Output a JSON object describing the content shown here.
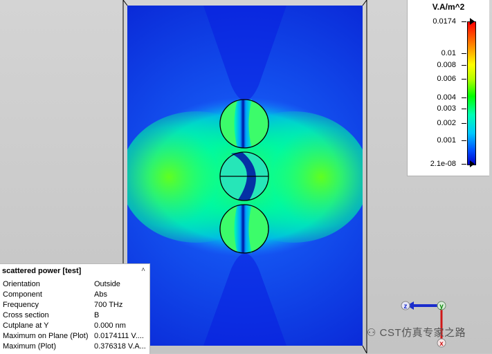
{
  "legend": {
    "unit": "V.A/m^2",
    "ticks": [
      "0.0174",
      "0.01",
      "0.008",
      "0.006",
      "0.004",
      "0.003",
      "0.002",
      "0.001",
      "2.1e-08"
    ],
    "colors": {
      "min": "#0000c8",
      "max": "#ff0000"
    }
  },
  "info": {
    "title": "scattered power [test]",
    "rows": [
      {
        "key": "Orientation",
        "value": "Outside"
      },
      {
        "key": "Component",
        "value": "Abs"
      },
      {
        "key": "Frequency",
        "value": "700 THz"
      },
      {
        "key": "Cross section",
        "value": "B"
      },
      {
        "key": "Cutplane at Y",
        "value": "0.000 nm"
      },
      {
        "key": "Maximum on Plane (Plot)",
        "value": "0.0174111 V...."
      },
      {
        "key": "Maximum (Plot)",
        "value": "0.376318 V.A..."
      }
    ]
  },
  "axes": {
    "z": "z",
    "y": "y",
    "x": "x"
  },
  "watermark": {
    "text": "CST仿真专家之路"
  }
}
